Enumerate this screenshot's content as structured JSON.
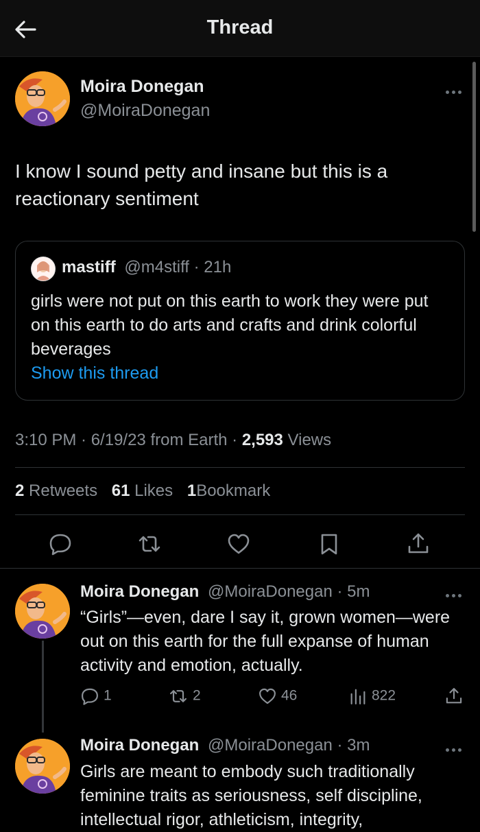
{
  "header": {
    "title": "Thread",
    "back_icon": "arrow-left-icon"
  },
  "main_tweet": {
    "name": "Moira Donegan",
    "handle": "@MoiraDonegan",
    "text": "I know I sound petty and insane but this is a reactionary sentiment",
    "quote": {
      "name": "mastiff",
      "handle_time": "@m4stiff · 21h",
      "text": "girls were not put on this earth to work they were put on this earth to do arts and crafts and drink colorful beverages",
      "link": "Show this thread"
    },
    "meta": {
      "time_date": "3:10 PM · 6/19/23 from Earth · ",
      "views_count": "2,593",
      "views_label": " Views"
    },
    "stats": {
      "retweets_count": "2",
      "retweets_label": "Retweets",
      "likes_count": "61",
      "likes_label": "Likes",
      "bookmarks_count": "1",
      "bookmarks_label": "Bookmark"
    },
    "actions": [
      "reply-icon",
      "retweet-icon",
      "like-icon",
      "bookmark-icon",
      "share-icon"
    ]
  },
  "replies": [
    {
      "name": "Moira Donegan",
      "handle_time": "@MoiraDonegan · 5m",
      "text": "“Girls”—even, dare I say it, grown women—were out on this earth for the full expanse of human activity and emotion, actually.",
      "replies": "1",
      "retweets": "2",
      "likes": "46",
      "views": "822"
    },
    {
      "name": "Moira Donegan",
      "handle_time": "@MoiraDonegan · 3m",
      "text": "Girls are meant to embody such traditionally feminine traits as seriousness, self discipline, intellectual rigor, athleticism, integrity,"
    }
  ],
  "colors": {
    "background": "#000000",
    "text": "#e7e9ea",
    "muted": "#8b9096",
    "link": "#1d9bf0",
    "border": "#2f3336",
    "avatar_bg": "#f6a02a"
  }
}
